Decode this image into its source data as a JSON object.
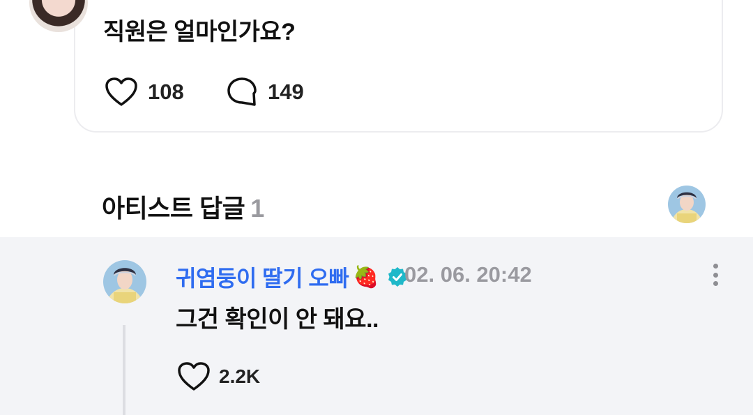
{
  "post": {
    "text": "직원은 얼마인가요?",
    "likes": "108",
    "comments": "149"
  },
  "section": {
    "title": "아티스트 답글",
    "count": "1"
  },
  "reply": {
    "author": "귀염둥이 딸기 오빠",
    "emoji": "🍓",
    "time": "02. 06. 20:42",
    "text": "그건 확인이 안 돼요..",
    "likes": "2.2K"
  },
  "colors": {
    "author_blue": "#2f6cf0",
    "verified_teal": "#1fb8c9",
    "muted_gray": "#9a9aa0",
    "reply_bg": "#f3f4f7"
  },
  "icons": [
    "heart-outline-icon",
    "speech-bubble-icon",
    "verified-badge-icon",
    "more-vertical-icon"
  ]
}
